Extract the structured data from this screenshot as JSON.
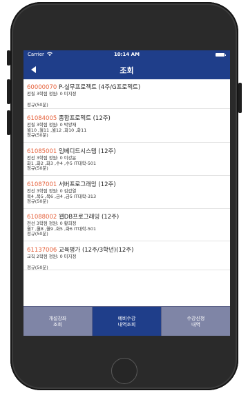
{
  "status_bar": {
    "carrier": "Carrier",
    "time": "10:14 AM",
    "wifi_icon": "wifi-icon",
    "battery_icon": "battery-icon"
  },
  "nav": {
    "back_icon": "back-arrow-icon",
    "title": "조회"
  },
  "courses": [
    {
      "code": "60000070",
      "name": "P-실무프로젝트 (4주/G프로젝트)",
      "line1": "전필 3학점 정원: 0 미지정",
      "line2": "",
      "line3": "정규(50분)"
    },
    {
      "code": "61084005",
      "name": "종합프로젝트 (12주)",
      "line1": "전필 3학점 정원: 0 박양재",
      "line2": "월10 ,월11 ,월12 ,화10 ,화11",
      "line3": "정규(50분)"
    },
    {
      "code": "61085001",
      "name": "임베디드시스템 (12주)",
      "line1": "전선 3학점 정원: 0 이강윤",
      "line2": "화1 ,화2 ,화3 ,수4 ,수5 IT대학-501",
      "line3": "정규(50분)"
    },
    {
      "code": "61087001",
      "name": "서버프로그래밍 (12주)",
      "line1": "전선 3학점 정원: 0 김갑열",
      "line2": "목4 ,목5 ,목6 ,금4 ,금5 IT대학-313",
      "line3": "정규(50분)"
    },
    {
      "code": "61088002",
      "name": "웹DB프로그래밍 (12주)",
      "line1": "전선 3학점 정원: 0 황희정",
      "line2": "월7 ,월8 ,월9 ,화5 ,화6 IT대학-501",
      "line3": "정규(50분)"
    },
    {
      "code": "61137006",
      "name": "교육평가 (12주/3학년)(12주)",
      "line1": "교직 2학점 정원: 0 미지정",
      "line2": "",
      "line3": "정규(50분)"
    }
  ],
  "tabs": [
    {
      "label": "개설강좌\n조회",
      "active": false
    },
    {
      "label": "예비수강\n내역조회",
      "active": true
    },
    {
      "label": "수강신청\n내역",
      "active": false
    }
  ],
  "colors": {
    "nav_bar": "#1f3e8a",
    "course_code": "#e5603a",
    "tab_bar": "#7f85a6",
    "tab_active": "#1f3e8a"
  }
}
